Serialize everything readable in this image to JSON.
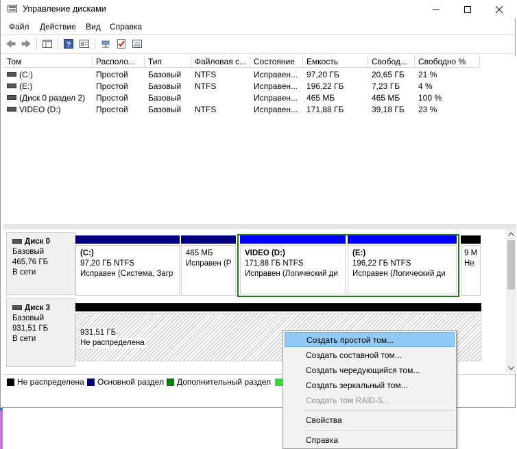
{
  "window": {
    "title": "Управление дисками"
  },
  "menu": [
    "Файл",
    "Действие",
    "Вид",
    "Справка"
  ],
  "volumes": {
    "columns": [
      "Том",
      "Располо...",
      "Тип",
      "Файловая с...",
      "Состояние",
      "Емкость",
      "Свобод...",
      "Свободно %"
    ],
    "rows": [
      [
        "(C:)",
        "Простой",
        "Базовый",
        "NTFS",
        "Исправен...",
        "97,20 ГБ",
        "20,65 ГБ",
        "21 %"
      ],
      [
        "(E:)",
        "Простой",
        "Базовый",
        "NTFS",
        "Исправен...",
        "196,22 ГБ",
        "7,23 ГБ",
        "4 %"
      ],
      [
        "(Диск 0 раздел 2)",
        "Простой",
        "Базовый",
        "",
        "Исправен...",
        "465 МБ",
        "465 МБ",
        "100 %"
      ],
      [
        "VIDEO (D:)",
        "Простой",
        "Базовый",
        "NTFS",
        "Исправен...",
        "171,88 ГБ",
        "39,18 ГБ",
        "23 %"
      ]
    ]
  },
  "disks": [
    {
      "name": "Диск 0",
      "type": "Базовый",
      "size": "465,76 ГБ",
      "status": "В сети",
      "partitions": [
        {
          "title": "(C:)",
          "size": "97,20 ГБ NTFS",
          "status": "Исправен (Система, Загр"
        },
        {
          "title": "",
          "size": "465 МБ",
          "status": "Исправен (Р"
        },
        {
          "title": "VIDEO  (D:)",
          "size": "171,88 ГБ NTFS",
          "status": "Исправен (Логический ди"
        },
        {
          "title": "(E:)",
          "size": "196,22 ГБ NTFS",
          "status": "Исправен (Логический ди"
        },
        {
          "title": "",
          "size": "9 М",
          "status": "Не"
        }
      ]
    },
    {
      "name": "Диск 3",
      "type": "Базовый",
      "size": "931,51 ГБ",
      "status": "В сети",
      "partitions": [
        {
          "size": "931,51 ГБ",
          "status": "Не распределена"
        }
      ]
    }
  ],
  "legend": [
    {
      "label": "Не распределена",
      "color": "#000000"
    },
    {
      "label": "Основной раздел",
      "color": "#000080"
    },
    {
      "label": "Дополнительный раздел",
      "color": "#008000"
    },
    {
      "label": "",
      "color": "#33dd33"
    }
  ],
  "context_menu": [
    {
      "label": "Создать простой том...",
      "enabled": true,
      "highlighted": true
    },
    {
      "label": "Создать составной том...",
      "enabled": true
    },
    {
      "label": "Создать чередующийся том...",
      "enabled": true
    },
    {
      "label": "Создать зеркальный том...",
      "enabled": true
    },
    {
      "label": "Создать том RAID-5...",
      "enabled": false
    },
    {
      "label": "Свойства",
      "enabled": true
    },
    {
      "label": "Справка",
      "enabled": true
    }
  ],
  "colors": {
    "primary": "#000080",
    "logical": "#0000ff",
    "extended": "#008000",
    "unallocated": "#000000",
    "highlight": "#91c9f7"
  },
  "icons": [
    "back-icon",
    "forward-icon",
    "console-tree-icon",
    "help-icon",
    "properties-icon",
    "connect-icon",
    "checkmark-icon",
    "list-icon",
    "drive-icon"
  ]
}
